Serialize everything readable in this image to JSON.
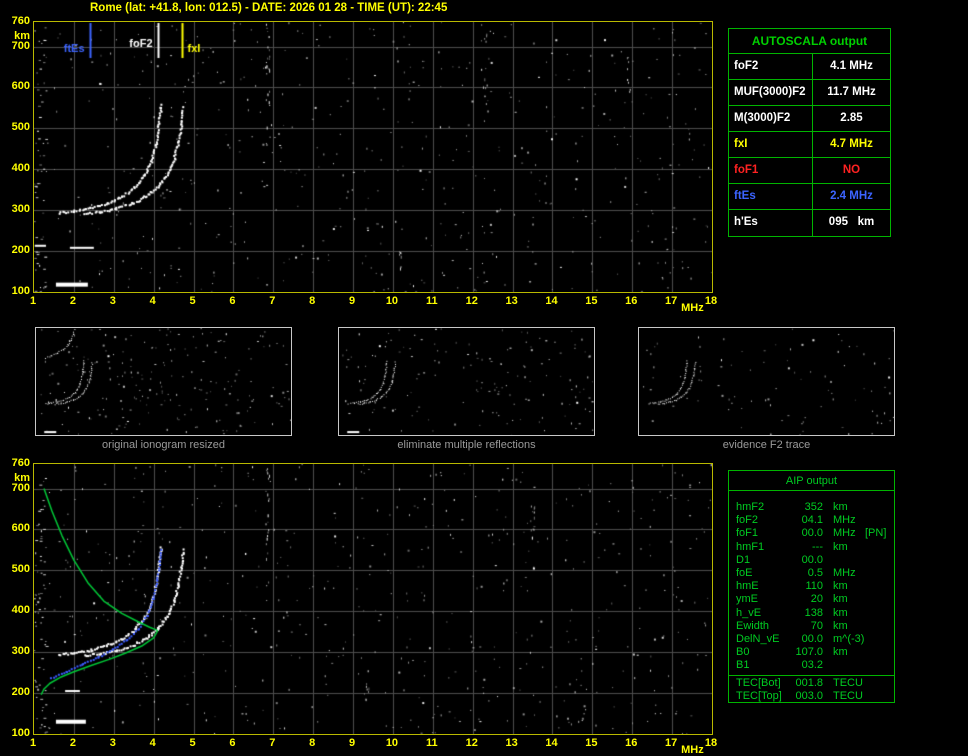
{
  "title": "Rome (lat: +41.8, lon: 012.5) - DATE: 2026 01 28 - TIME (UT): 22:45",
  "autoscala": {
    "title": "AUTOSCALA output",
    "rows": [
      {
        "label": "foF2",
        "value": "4.1 MHz",
        "color": "#ffffff"
      },
      {
        "label": "MUF(3000)F2",
        "value": "11.7 MHz",
        "color": "#ffffff"
      },
      {
        "label": "M(3000)F2",
        "value": "2.85",
        "color": "#ffffff"
      },
      {
        "label": "fxI",
        "value": "4.7 MHz",
        "color": "#ffff00"
      },
      {
        "label": "foF1",
        "value": "NO",
        "color": "#ff2222"
      },
      {
        "label": "ftEs",
        "value": "2.4 MHz",
        "color": "#3c64ff"
      },
      {
        "label": "h'Es",
        "value": "095   km",
        "color": "#ffffff"
      }
    ]
  },
  "aip": {
    "title": "AIP output",
    "rows": [
      {
        "label": "hmF2",
        "value": "352",
        "unit": "km",
        "extra": ""
      },
      {
        "label": "foF2",
        "value": "04.1",
        "unit": "MHz",
        "extra": ""
      },
      {
        "label": "foF1",
        "value": "00.0",
        "unit": "MHz",
        "extra": "[PN]"
      },
      {
        "label": "hmF1",
        "value": "---",
        "unit": "km",
        "extra": ""
      },
      {
        "label": "D1",
        "value": "00.0",
        "unit": "",
        "extra": ""
      },
      {
        "label": "foE",
        "value": "0.5",
        "unit": "MHz",
        "extra": ""
      },
      {
        "label": "hmE",
        "value": "110",
        "unit": "km",
        "extra": ""
      },
      {
        "label": "ymE",
        "value": "20",
        "unit": "km",
        "extra": ""
      },
      {
        "label": "h_vE",
        "value": "138",
        "unit": "km",
        "extra": ""
      },
      {
        "label": "Ewidth",
        "value": "70",
        "unit": "km",
        "extra": ""
      },
      {
        "label": "DelN_vE",
        "value": "00.0",
        "unit": "m^(-3)",
        "extra": ""
      },
      {
        "label": "B0",
        "value": "107.0",
        "unit": "km",
        "extra": ""
      },
      {
        "label": "B1",
        "value": "03.2",
        "unit": "",
        "extra": ""
      },
      {
        "label": "TEC[Bot]",
        "value": "001.8",
        "unit": "TECU",
        "extra": "",
        "sep": true
      },
      {
        "label": "TEC[Top]",
        "value": "003.0",
        "unit": "TECU",
        "extra": ""
      }
    ]
  },
  "thumbnails": {
    "captions": [
      "original ionogram resized",
      "eliminate multiple reflections",
      "evidence F2 trace"
    ]
  },
  "chart_data": {
    "type": "scatter",
    "title": "Ionogram, Rome, 2026-01-28 22:45 UT (virtual height vs frequency)",
    "xlabel": "MHz",
    "ylabel": "km",
    "x_ticks": [
      1,
      2,
      3,
      4,
      5,
      6,
      7,
      8,
      9,
      10,
      11,
      12,
      13,
      14,
      15,
      16,
      17,
      18
    ],
    "y_ticks": [
      760,
      700,
      600,
      500,
      400,
      300,
      200,
      100
    ],
    "x_range": [
      1,
      18
    ],
    "y_range": [
      100,
      760
    ],
    "grid": true,
    "markers": [
      {
        "name": "ftEs",
        "freq_mhz": 2.4,
        "color": "#3c64ff"
      },
      {
        "name": "foF2",
        "freq_mhz": 4.1,
        "color": "#ffffff"
      },
      {
        "name": "fxI",
        "freq_mhz": 4.7,
        "color": "#ffff00"
      }
    ],
    "traces": {
      "f2_ordinary": [
        [
          1.6,
          295
        ],
        [
          2.0,
          300
        ],
        [
          2.4,
          307
        ],
        [
          2.8,
          318
        ],
        [
          3.2,
          335
        ],
        [
          3.5,
          357
        ],
        [
          3.75,
          385
        ],
        [
          3.92,
          420
        ],
        [
          4.03,
          460
        ],
        [
          4.1,
          505
        ],
        [
          4.15,
          545
        ],
        [
          4.17,
          560
        ]
      ],
      "f2_extraordinary": [
        [
          2.25,
          293
        ],
        [
          2.65,
          298
        ],
        [
          3.05,
          306
        ],
        [
          3.45,
          318
        ],
        [
          3.8,
          336
        ],
        [
          4.1,
          360
        ],
        [
          4.32,
          390
        ],
        [
          4.5,
          428
        ],
        [
          4.6,
          468
        ],
        [
          4.68,
          512
        ],
        [
          4.72,
          552
        ]
      ],
      "es_layer": [
        [
          1.55,
          118
        ],
        [
          2.35,
          118
        ]
      ],
      "es_second_hop": [
        [
          1.9,
          208
        ],
        [
          2.5,
          208
        ]
      ],
      "f2_multiple": [
        [
          1.6,
          578
        ],
        [
          2.0,
          592
        ],
        [
          2.4,
          608
        ],
        [
          2.8,
          630
        ],
        [
          3.1,
          658
        ],
        [
          3.3,
          688
        ],
        [
          3.45,
          722
        ],
        [
          3.55,
          750
        ]
      ],
      "profile_green": [
        [
          1.25,
          700
        ],
        [
          1.45,
          645
        ],
        [
          1.7,
          585
        ],
        [
          2.0,
          525
        ],
        [
          2.35,
          470
        ],
        [
          2.75,
          425
        ],
        [
          3.2,
          395
        ],
        [
          3.6,
          375
        ],
        [
          3.9,
          361
        ],
        [
          4.08,
          354
        ],
        [
          4.1,
          352
        ],
        [
          4.0,
          335
        ],
        [
          3.7,
          315
        ],
        [
          3.3,
          298
        ],
        [
          2.9,
          283
        ],
        [
          2.45,
          268
        ],
        [
          2.0,
          252
        ],
        [
          1.65,
          238
        ],
        [
          1.4,
          224
        ],
        [
          1.25,
          210
        ],
        [
          1.18,
          196
        ]
      ],
      "restored_blue": [
        [
          1.4,
          238
        ],
        [
          1.8,
          255
        ],
        [
          2.2,
          272
        ],
        [
          2.6,
          290
        ],
        [
          2.95,
          309
        ],
        [
          3.3,
          331
        ],
        [
          3.6,
          358
        ],
        [
          3.82,
          392
        ],
        [
          3.97,
          432
        ],
        [
          4.07,
          478
        ],
        [
          4.14,
          524
        ],
        [
          4.17,
          552
        ]
      ]
    },
    "noise_seed": 20260128
  }
}
